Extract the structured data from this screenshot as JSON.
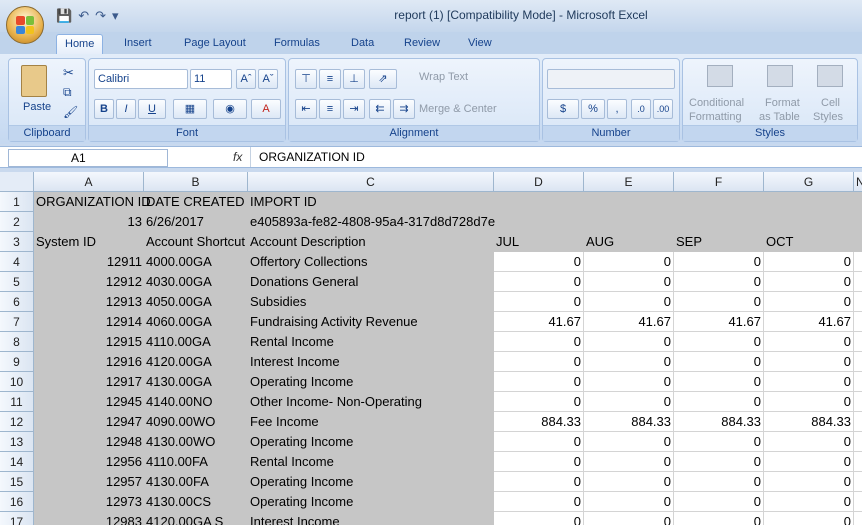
{
  "window": {
    "title": "report (1)  [Compatibility Mode] - Microsoft Excel"
  },
  "tabs": [
    "Home",
    "Insert",
    "Page Layout",
    "Formulas",
    "Data",
    "Review",
    "View"
  ],
  "ribbon": {
    "clipboard": {
      "label": "Clipboard",
      "paste": "Paste"
    },
    "font": {
      "label": "Font",
      "name": "Calibri",
      "size": "11"
    },
    "alignment": {
      "label": "Alignment",
      "wrap_text": "Wrap Text",
      "merge_center": "Merge & Center"
    },
    "number": {
      "label": "Number",
      "currency": "$",
      "percent": "%",
      "comma": ","
    },
    "styles": {
      "label": "Styles",
      "conditional": "Conditional",
      "formatting": "Formatting",
      "format": "Format",
      "as_table": "as Table",
      "cell": "Cell",
      "cell_styles": "Styles"
    }
  },
  "formula_bar": {
    "name_box": "A1",
    "fx": "fx",
    "content": "ORGANIZATION ID"
  },
  "columns": [
    "A",
    "B",
    "C",
    "D",
    "E",
    "F",
    "G"
  ],
  "rows": [
    {
      "n": "1",
      "a": "ORGANIZATION ID",
      "b": "DATE CREATED",
      "c": "IMPORT ID",
      "d": "",
      "e": "",
      "f": "",
      "g": ""
    },
    {
      "n": "2",
      "a": "13",
      "b": "6/26/2017",
      "c": "e405893a-fe82-4808-95a4-317d8d728d7e",
      "d": "",
      "e": "",
      "f": "",
      "g": ""
    },
    {
      "n": "3",
      "a": "System ID",
      "b": "Account Shortcut",
      "c": "Account Description",
      "d": "JUL",
      "e": "AUG",
      "f": "SEP",
      "g": "OCT"
    },
    {
      "n": "4",
      "a": "12911",
      "b": "4000.00GA",
      "c": "Offertory Collections",
      "d": "0",
      "e": "0",
      "f": "0",
      "g": "0"
    },
    {
      "n": "5",
      "a": "12912",
      "b": "4030.00GA",
      "c": "Donations  General",
      "d": "0",
      "e": "0",
      "f": "0",
      "g": "0"
    },
    {
      "n": "6",
      "a": "12913",
      "b": "4050.00GA",
      "c": "Subsidies",
      "d": "0",
      "e": "0",
      "f": "0",
      "g": "0"
    },
    {
      "n": "7",
      "a": "12914",
      "b": "4060.00GA",
      "c": "Fundraising Activity Revenue",
      "d": "41.67",
      "e": "41.67",
      "f": "41.67",
      "g": "41.67"
    },
    {
      "n": "8",
      "a": "12915",
      "b": "4110.00GA",
      "c": "Rental Income",
      "d": "0",
      "e": "0",
      "f": "0",
      "g": "0"
    },
    {
      "n": "9",
      "a": "12916",
      "b": "4120.00GA",
      "c": "Interest Income",
      "d": "0",
      "e": "0",
      "f": "0",
      "g": "0"
    },
    {
      "n": "10",
      "a": "12917",
      "b": "4130.00GA",
      "c": "Operating Income",
      "d": "0",
      "e": "0",
      "f": "0",
      "g": "0"
    },
    {
      "n": "11",
      "a": "12945",
      "b": "4140.00NO",
      "c": "Other Income- Non-Operating",
      "d": "0",
      "e": "0",
      "f": "0",
      "g": "0"
    },
    {
      "n": "12",
      "a": "12947",
      "b": "4090.00WO",
      "c": "Fee Income",
      "d": "884.33",
      "e": "884.33",
      "f": "884.33",
      "g": "884.33"
    },
    {
      "n": "13",
      "a": "12948",
      "b": "4130.00WO",
      "c": "Operating Income",
      "d": "0",
      "e": "0",
      "f": "0",
      "g": "0"
    },
    {
      "n": "14",
      "a": "12956",
      "b": "4110.00FA",
      "c": "Rental Income",
      "d": "0",
      "e": "0",
      "f": "0",
      "g": "0"
    },
    {
      "n": "15",
      "a": "12957",
      "b": "4130.00FA",
      "c": "Operating Income",
      "d": "0",
      "e": "0",
      "f": "0",
      "g": "0"
    },
    {
      "n": "16",
      "a": "12973",
      "b": "4130.00CS",
      "c": "Operating Income",
      "d": "0",
      "e": "0",
      "f": "0",
      "g": "0"
    },
    {
      "n": "17",
      "a": "12983",
      "b": "4120.00GA S",
      "c": "Interest Income",
      "d": "0",
      "e": "0",
      "f": "0",
      "g": "0"
    }
  ],
  "extra_header": "N"
}
